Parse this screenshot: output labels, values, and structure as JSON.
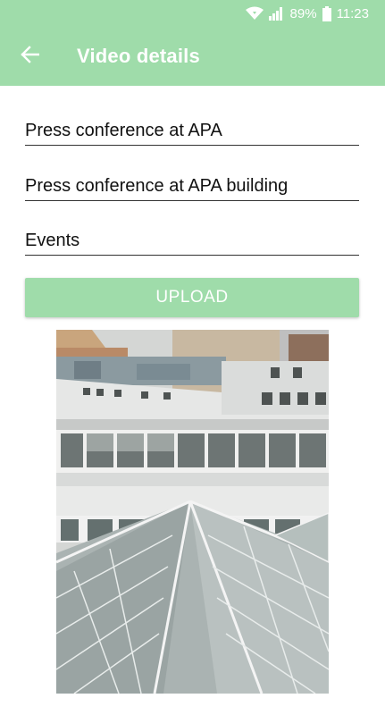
{
  "status_bar": {
    "battery": "89%",
    "time": "11:23",
    "icons": [
      "wifi-icon",
      "signal-icon",
      "battery-icon"
    ]
  },
  "app_bar": {
    "title": "Video details",
    "back_icon": "arrow-left-icon",
    "color": "#9fdcaa"
  },
  "form": {
    "title_value": "Press conference at APA",
    "description_value": "Press conference at APA building",
    "category_value": "Events",
    "upload_label": "UPLOAD"
  },
  "thumbnail": {
    "description_icon": "video-thumbnail"
  }
}
